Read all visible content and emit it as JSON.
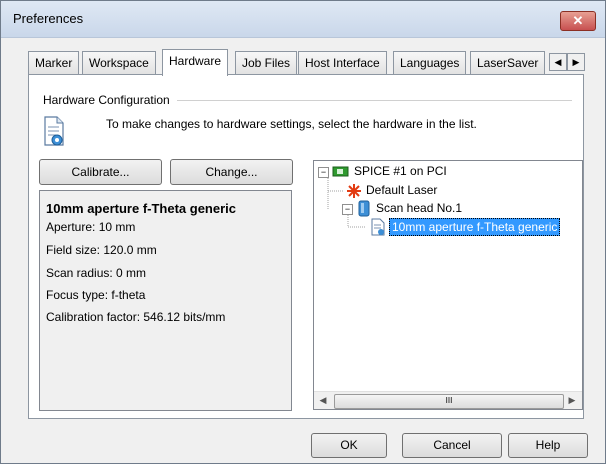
{
  "window": {
    "title": "Preferences",
    "close_label": "✕"
  },
  "tabs": [
    {
      "label": "Marker"
    },
    {
      "label": "Workspace"
    },
    {
      "label": "Hardware"
    },
    {
      "label": "Job Files"
    },
    {
      "label": "Host Interface"
    },
    {
      "label": "Languages"
    },
    {
      "label": "LaserSaver"
    }
  ],
  "tab_scroll": {
    "left": "◀",
    "right": "▶"
  },
  "hardware": {
    "group_label": "Hardware Configuration",
    "hint": "To make changes to hardware settings, select the hardware in the list.",
    "calibrate_label": "Calibrate...",
    "change_label": "Change...",
    "info": {
      "title": "10mm aperture f-Theta generic",
      "lines": [
        "Aperture: 10 mm",
        "Field size: 120.0 mm",
        "Scan radius: 0 mm",
        "Focus type: f-theta",
        "Calibration factor: 546.12 bits/mm"
      ]
    },
    "tree": [
      {
        "label": "SPICE #1 on PCI",
        "icon": "board-icon"
      },
      {
        "label": "Default Laser",
        "icon": "laser-icon"
      },
      {
        "label": "Scan head No.1",
        "icon": "scan-head-icon"
      },
      {
        "label": "10mm aperture f-Theta generic",
        "icon": "lens-document-icon",
        "selected": true
      }
    ],
    "scroll": {
      "left": "◀",
      "right": "▶",
      "thumb": "III"
    }
  },
  "footer": {
    "ok_label": "OK",
    "cancel_label": "Cancel",
    "help_label": "Help"
  }
}
